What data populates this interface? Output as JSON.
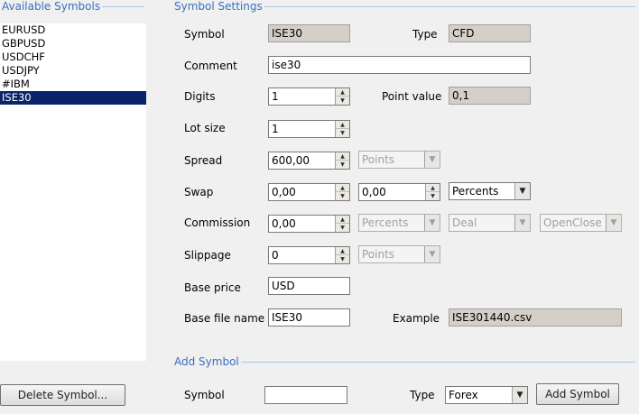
{
  "available_symbols": {
    "title": "Available Symbols",
    "items": [
      "EURUSD",
      "GBPUSD",
      "USDCHF",
      "USDJPY",
      "#IBM",
      "ISE30"
    ],
    "selected": "ISE30",
    "delete_button": "Delete Symbol..."
  },
  "symbol_settings": {
    "title": "Symbol Settings",
    "symbol_label": "Symbol",
    "symbol_value": "ISE30",
    "type_label": "Type",
    "type_value": "CFD",
    "comment_label": "Comment",
    "comment_value": "ise30",
    "digits_label": "Digits",
    "digits_value": "1",
    "point_value_label": "Point value",
    "point_value": "0,1",
    "lot_size_label": "Lot size",
    "lot_size_value": "1",
    "spread_label": "Spread",
    "spread_value": "600,00",
    "spread_unit": "Points",
    "swap_label": "Swap",
    "swap_long": "0,00",
    "swap_short": "0,00",
    "swap_unit": "Percents",
    "commission_label": "Commission",
    "commission_value": "0,00",
    "commission_unit": "Percents",
    "commission_type": "Deal",
    "commission_mode": "OpenClose",
    "slippage_label": "Slippage",
    "slippage_value": "0",
    "slippage_unit": "Points",
    "base_price_label": "Base price",
    "base_price_value": "USD",
    "base_file_label": "Base file name",
    "base_file_value": "ISE30",
    "example_label": "Example",
    "example_value": "ISE301440.csv"
  },
  "add_symbol": {
    "title": "Add Symbol",
    "symbol_label": "Symbol",
    "symbol_value": "",
    "type_label": "Type",
    "type_value": "Forex",
    "add_button": "Add Symbol"
  }
}
